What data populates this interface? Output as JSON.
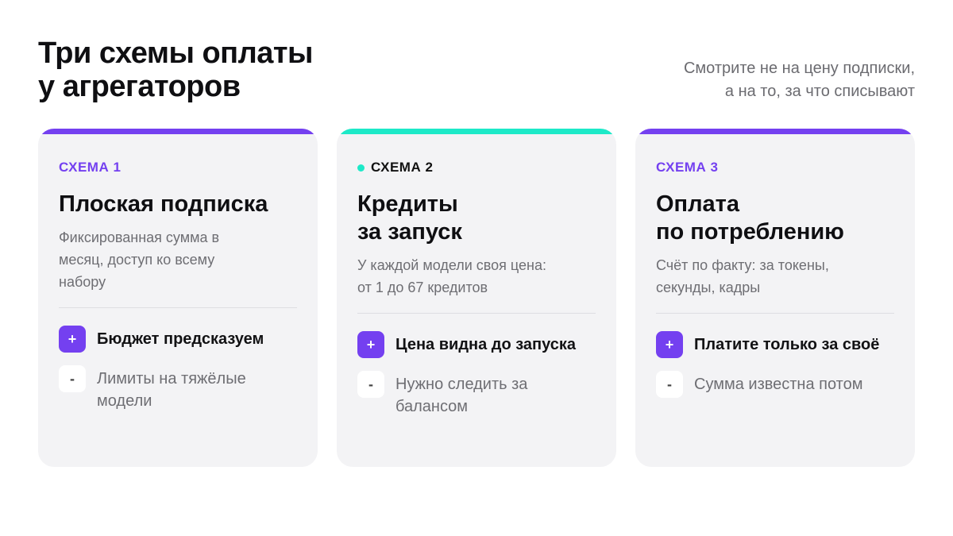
{
  "header": {
    "title_lines": [
      "Три схемы оплаты",
      "у агрегаторов"
    ],
    "subtitle_lines": [
      "Смотрите не на цену подписки,",
      "а на то, за что списывают"
    ]
  },
  "colors": {
    "purple": "#7440f0",
    "teal": "#1de9c8",
    "card_bg": "#f3f3f5"
  },
  "cards": [
    {
      "accent": "#7440f0",
      "label": "СХЕМА 1",
      "label_color": "#7440f0",
      "title_lines": [
        "Плоская подписка"
      ],
      "desc_lines": [
        "Фиксированная сумма в",
        "месяц, доступ ко всему",
        "набору"
      ],
      "pro_icon": "+",
      "pro_lines": [
        "Бюджет предсказуем"
      ],
      "con_icon": "-",
      "con_lines": [
        "Лимиты на тяжёлые",
        "модели"
      ]
    },
    {
      "accent": "#1de9c8",
      "label": "СХЕМА 2",
      "label_color": "#111111",
      "title_lines": [
        "Кредиты",
        "за запуск"
      ],
      "desc_lines": [
        "У каждой модели своя цена:",
        "от 1 до 67 кредитов"
      ],
      "pro_icon": "+",
      "pro_lines": [
        "Цена видна до запуска"
      ],
      "con_icon": "-",
      "con_lines": [
        "Нужно следить за",
        "балансом"
      ]
    },
    {
      "accent": "#7440f0",
      "label": "СХЕМА 3",
      "label_color": "#7440f0",
      "title_lines": [
        "Оплата",
        "по потреблению"
      ],
      "desc_lines": [
        "Счёт по факту: за токены,",
        "секунды, кадры"
      ],
      "pro_icon": "+",
      "pro_lines": [
        "Платите только за своё"
      ],
      "con_icon": "-",
      "con_lines": [
        "Сумма известна потом"
      ]
    }
  ]
}
